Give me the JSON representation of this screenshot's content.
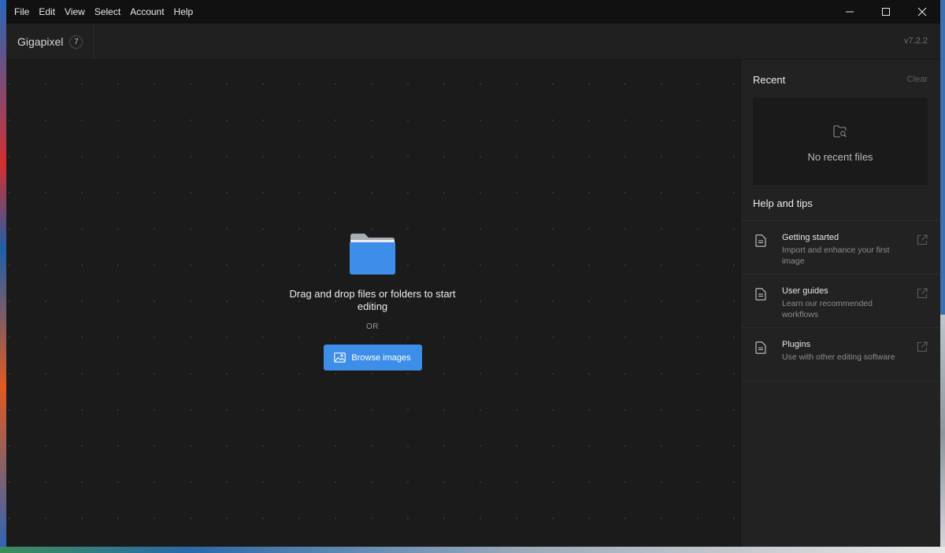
{
  "menu": [
    "File",
    "Edit",
    "View",
    "Select",
    "Account",
    "Help"
  ],
  "window_controls": [
    "minimize-icon",
    "maximize-icon",
    "close-icon"
  ],
  "app": {
    "title": "Gigapixel",
    "badge": "7",
    "version": "v7.2.2"
  },
  "dropzone": {
    "icon": "folder-icon",
    "text": "Drag and drop files or folders to start editing",
    "or": "OR",
    "browse_label": "Browse images",
    "accent": "#3d8ee8"
  },
  "recent": {
    "title": "Recent",
    "clear": "Clear",
    "empty": "No recent files"
  },
  "help": {
    "title": "Help and tips",
    "items": [
      {
        "title": "Getting started",
        "desc": "Import and enhance your first image"
      },
      {
        "title": "User guides",
        "desc": "Learn our recommended workflows"
      },
      {
        "title": "Plugins",
        "desc": "Use with other editing software"
      }
    ]
  }
}
